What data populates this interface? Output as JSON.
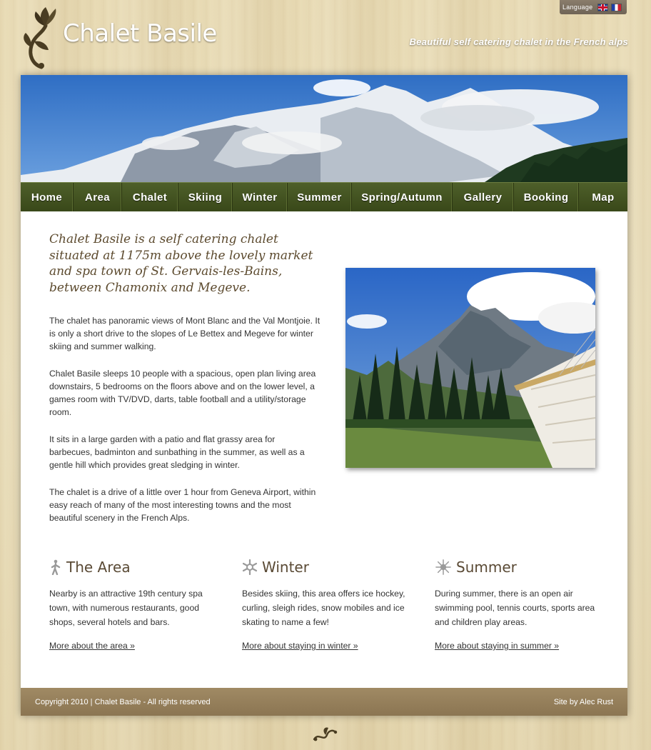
{
  "language": {
    "label": "Language",
    "flags": [
      "uk-flag-icon",
      "fr-flag-icon"
    ]
  },
  "brand": {
    "name": "Chalet Basile",
    "tagline": "Beautiful self catering chalet in the French alps",
    "logo_icon": "flower-swirl-icon"
  },
  "nav": {
    "items": [
      {
        "label": "Home",
        "w": 74
      },
      {
        "label": "Area",
        "w": 68
      },
      {
        "label": "Chalet",
        "w": 79
      },
      {
        "label": "Skiing",
        "w": 76
      },
      {
        "label": "Winter",
        "w": 77
      },
      {
        "label": "Summer",
        "w": 90
      },
      {
        "label": "Spring/Autumn",
        "w": 141
      },
      {
        "label": "Gallery",
        "w": 86
      },
      {
        "label": "Booking",
        "w": 91
      },
      {
        "label": "Map",
        "w": 68
      }
    ]
  },
  "intro": {
    "text": "Chalet Basile is a self catering chalet situated at 1175m above the lovely market and spa town of St. Gervais-les-Bains, between Chamonix and Megeve."
  },
  "body": {
    "p1": "The chalet has panoramic views of Mont Blanc and the Val Montjoie. It is only a short drive to the slopes of Le Bettex and Megeve for winter skiing and summer walking.",
    "p2": "Chalet Basile sleeps 10 people with a spacious, open plan living area downstairs, 5 bedrooms on the floors above and on the lower level, a games room with TV/DVD, darts, table football and a utility/storage room.",
    "p3": "It sits in a large garden with a patio and flat grassy area for barbecues, badminton and sunbathing in the summer, as well as a gentle hill which provides great sledging in winter.",
    "p4": "The chalet is a drive of a little over 1 hour from Geneva Airport, within easy reach of many of the most interesting towns and the most beautiful scenery in the French Alps."
  },
  "features": {
    "area": {
      "title": "The Area",
      "icon": "walking-person-icon",
      "text": "Nearby is an attractive 19th century spa town, with numerous restaurants, good shops, several hotels and bars.",
      "link": "More about the area »"
    },
    "winter": {
      "title": "Winter",
      "icon": "snowflake-icon",
      "text": "Besides skiing, this area offers ice hockey, curling, sleigh rides, snow mobiles and ice skating to name a few!",
      "link": "More about staying in winter »"
    },
    "summer": {
      "title": "Summer",
      "icon": "sun-icon",
      "text": "During summer, there is an open air swimming pool, tennis courts, sports area and children play areas.",
      "link": "More about staying in summer »"
    }
  },
  "footer": {
    "copyright": "Copyright 2010 | Chalet Basile - All rights reserved",
    "credit": "Site by Alec Rust"
  },
  "colors": {
    "nav": "#465623",
    "accent_brown": "#5c4a2e",
    "footer": "#957f5b"
  }
}
